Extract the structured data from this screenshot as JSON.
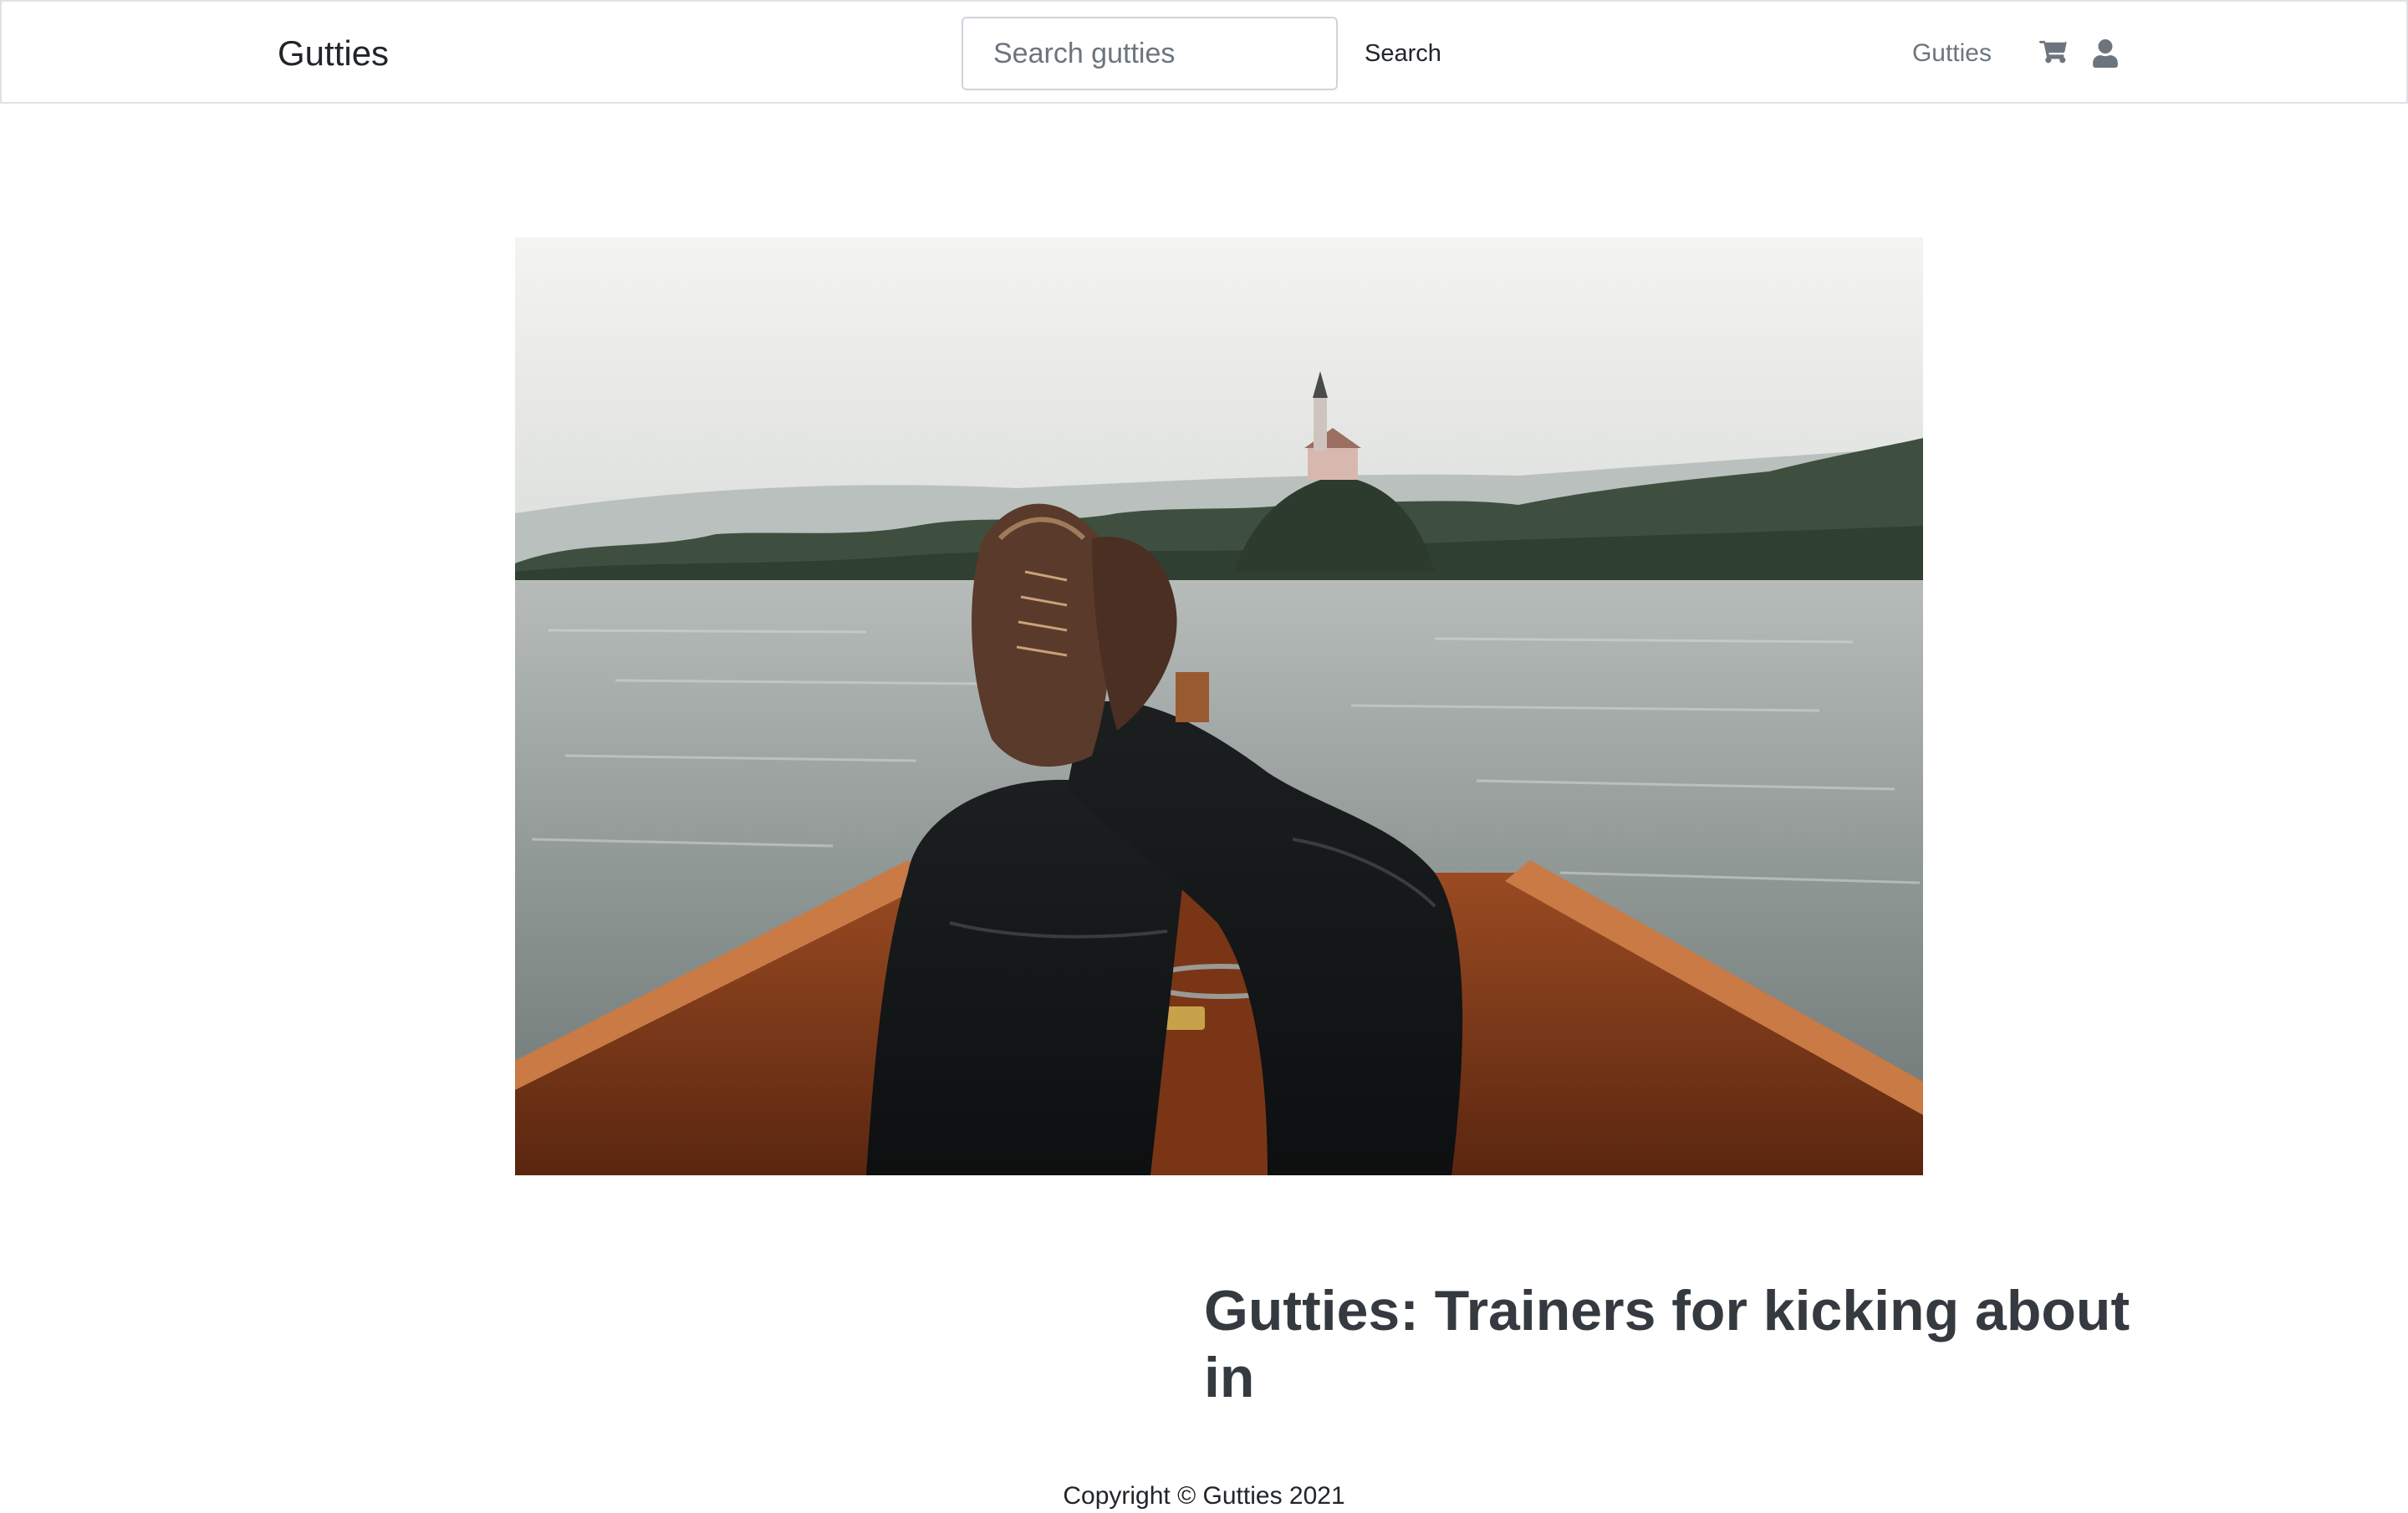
{
  "navbar": {
    "brand": "Gutties",
    "search_placeholder": "Search gutties",
    "search_button_label": "Search",
    "nav_link": "Gutties",
    "icons": [
      "cart-icon",
      "user-icon"
    ]
  },
  "hero": {
    "image_description": "hero-photo"
  },
  "main": {
    "headline": "Gutties: Trainers for kicking about in"
  },
  "footer": {
    "copyright": "Copyright © Gutties 2021"
  },
  "colors": {
    "nav_border": "#dee2e6",
    "muted_text": "#6c757d",
    "headline_text": "#343a40"
  }
}
